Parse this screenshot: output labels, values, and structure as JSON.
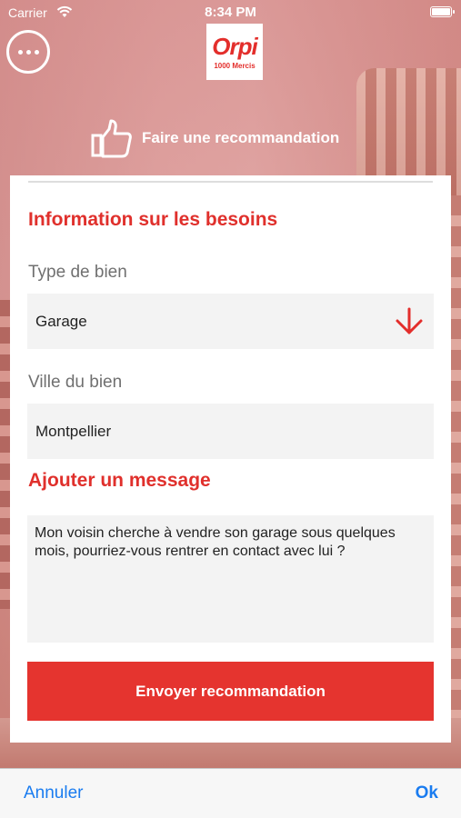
{
  "status_bar": {
    "carrier": "Carrier",
    "time": "8:34 PM"
  },
  "header": {
    "logo_word": "Orpi",
    "logo_sub": "1000 Mercis",
    "title": "Faire une recommandation"
  },
  "form": {
    "needs_title": "Information sur les besoins",
    "property_type_label": "Type de bien",
    "property_type_value": "Garage",
    "city_label": "Ville du bien",
    "city_value": "Montpellier",
    "message_title": "Ajouter un message",
    "message_value": "Mon voisin cherche à vendre son garage sous quelques mois, pourriez-vous rentrer en contact avec lui ?",
    "submit_label": "Envoyer recommandation"
  },
  "toolbar": {
    "cancel_label": "Annuler",
    "ok_label": "Ok"
  },
  "colors": {
    "accent": "#e32e2b",
    "link": "#1a7cf0"
  },
  "icons": [
    "wifi-icon",
    "battery-icon",
    "more-dots-icon",
    "thumbs-up-icon",
    "arrow-down-icon"
  ]
}
